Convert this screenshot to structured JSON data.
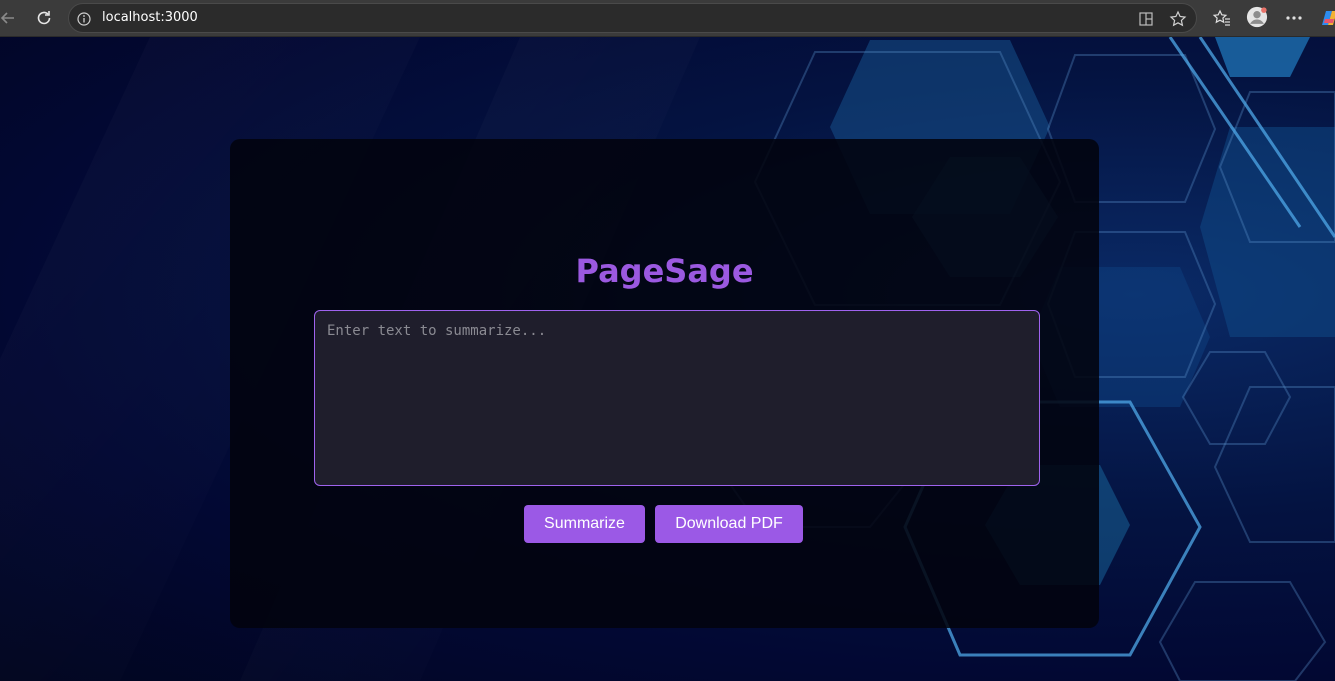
{
  "browser": {
    "url": "localhost:3000",
    "icons": {
      "back": "back-arrow-icon",
      "reload": "reload-icon",
      "site_info": "info-icon",
      "split_screen": "split-screen-icon",
      "favorite": "star-icon",
      "favorites": "favorites-icon",
      "profile": "profile-avatar",
      "menu": "more-icon",
      "copilot": "copilot-icon"
    }
  },
  "app": {
    "title": "PageSage",
    "input": {
      "placeholder": "Enter text to summarize...",
      "value": ""
    },
    "buttons": {
      "summarize": "Summarize",
      "download": "Download PDF"
    }
  },
  "colors": {
    "accent": "#9b59e6",
    "title": "#9b59e0",
    "card_bg": "#02030e",
    "page_bg": "#020625"
  }
}
